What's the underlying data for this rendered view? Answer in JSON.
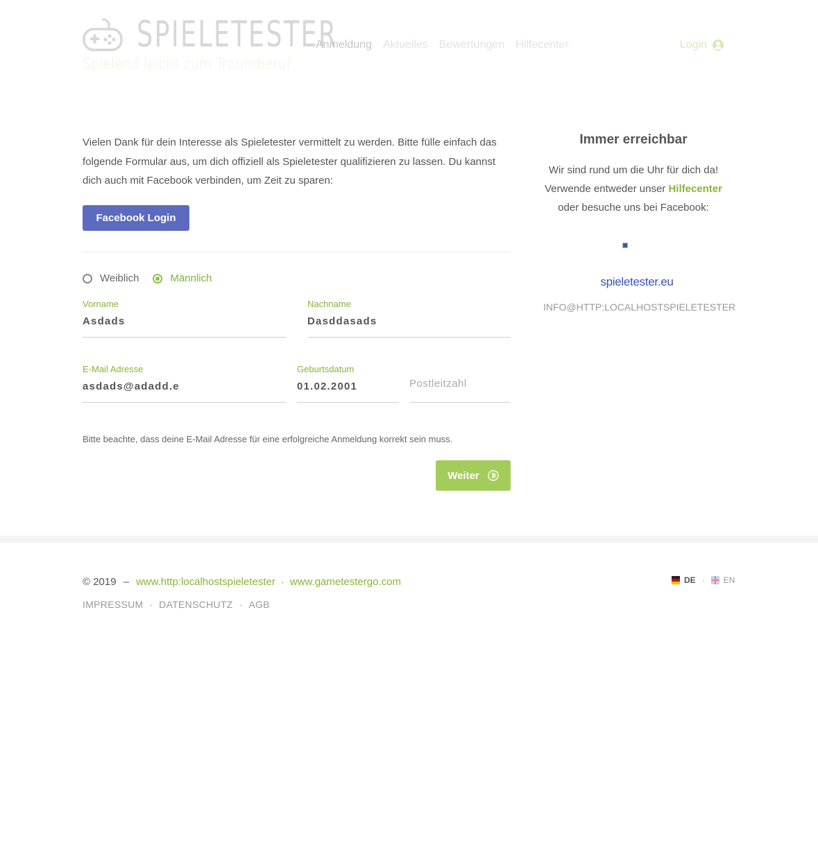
{
  "header": {
    "logo_word": "SPIELETESTER",
    "logo_tagline": "Spielend leicht zum Traumberuf",
    "nav": [
      {
        "label": "Anmeldung"
      },
      {
        "label": "Aktuelles"
      },
      {
        "label": "Bewertungen"
      },
      {
        "label": "Hilfecenter"
      }
    ],
    "login_label": "Login"
  },
  "main": {
    "intro": "Vielen Dank für dein Interesse als Spieletester vermittelt zu werden. Bitte fülle einfach das folgende Formular aus, um dich offiziell als Spieletester qualifizieren zu lassen. Du kannst dich auch mit Facebook verbinden, um Zeit zu sparen:",
    "facebook_login_label": "Facebook Login",
    "gender": {
      "options": [
        {
          "label": "Weiblich",
          "checked": false
        },
        {
          "label": "Männlich",
          "checked": true
        }
      ]
    },
    "fields": {
      "vorname": {
        "label": "Vorname",
        "value": "Asdads"
      },
      "nachname": {
        "label": "Nachname",
        "value": "Dasddasads"
      },
      "email": {
        "label": "E-Mail Adresse",
        "value": "asdads@adadd.e"
      },
      "geburtsdatum": {
        "label": "Geburtsdatum",
        "value": "01.02.2001"
      },
      "postleitzahl": {
        "placeholder": "Postleitzahl",
        "value": ""
      }
    },
    "note": "Bitte beachte, dass deine E-Mail Adresse für eine erfolgreiche Anmeldung korrekt sein muss.",
    "weiter_label": "Weiter"
  },
  "sidebar": {
    "title": "Immer erreichbar",
    "text_line1": "Wir sind rund um die Uhr für dich da!",
    "text_line2_prefix": "Verwende entweder unser",
    "hilfecenter_link": "Hilfecenter",
    "text_line3": "oder besuche uns bei Facebook:",
    "site_link": "spieletester.eu",
    "email": "INFO@HTTP:LOCALHOSTSPIELETESTER"
  },
  "footer": {
    "copyright": "© 2019",
    "dash": "–",
    "link1": "www.http:localhostspieletester",
    "link2": "www.gametestergo.com",
    "legal": [
      {
        "label": "IMPRESSUM"
      },
      {
        "label": "DATENSCHUTZ"
      },
      {
        "label": "AGB"
      }
    ],
    "lang_de": "DE",
    "lang_en": "EN"
  },
  "colors": {
    "accent_green": "#8bc34a",
    "button_green": "#a4cc5a",
    "facebook_blue": "#5c6bc0",
    "link_blue": "#3f51b5"
  }
}
